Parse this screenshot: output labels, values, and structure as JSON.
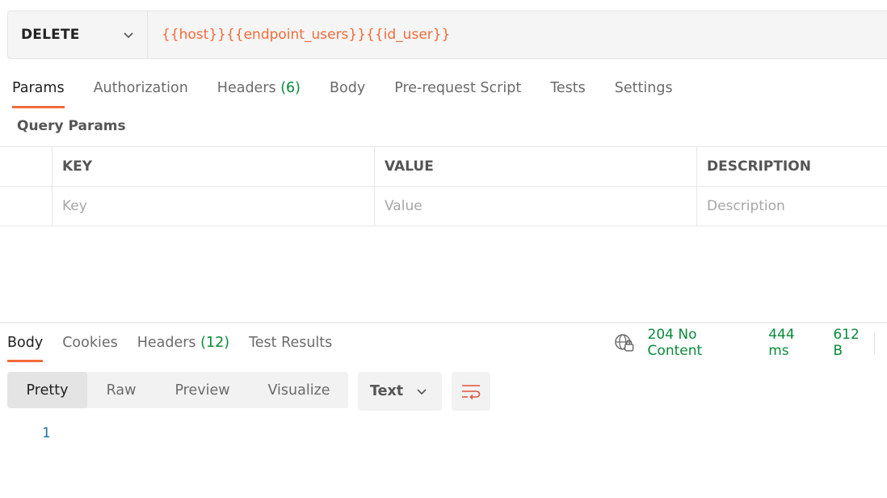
{
  "request": {
    "method": "DELETE",
    "url": "{{host}}{{endpoint_users}}{{id_user}}"
  },
  "request_tabs": {
    "params": "Params",
    "authorization": "Authorization",
    "headers": "Headers",
    "headers_count": "(6)",
    "body": "Body",
    "prerequest": "Pre-request Script",
    "tests": "Tests",
    "settings": "Settings"
  },
  "query_params": {
    "title": "Query Params",
    "columns": [
      "KEY",
      "VALUE",
      "DESCRIPTION"
    ],
    "placeholders": [
      "Key",
      "Value",
      "Description"
    ]
  },
  "response_tabs": {
    "body": "Body",
    "cookies": "Cookies",
    "headers": "Headers",
    "headers_count": "(12)",
    "test_results": "Test Results"
  },
  "status": {
    "code": "204 No Content",
    "time": "444 ms",
    "size": "612 B",
    "icon": "globe-lock-icon"
  },
  "view_modes": [
    "Pretty",
    "Raw",
    "Preview",
    "Visualize"
  ],
  "format": {
    "selected": "Text"
  },
  "editor": {
    "line_number": "1"
  },
  "colors": {
    "accent": "#f26b3a",
    "success": "#0b8a3b",
    "line_number": "#1b6fa3"
  }
}
